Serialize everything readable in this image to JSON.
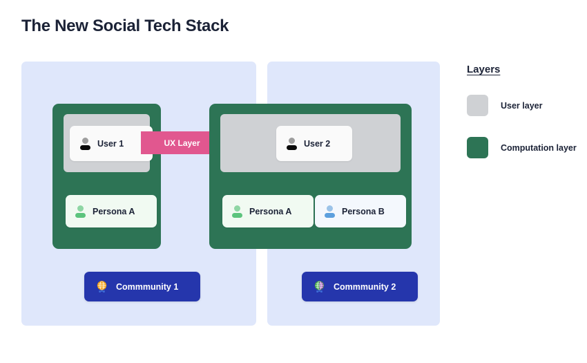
{
  "title": "The New Social Tech Stack",
  "colors": {
    "panel_blue": "#dfe7fb",
    "computation_green": "#2d7455",
    "user_gray": "#cfd1d4",
    "ux_pink": "#e1578f",
    "community_blue": "#2536ac",
    "text_dark": "#1b2236"
  },
  "groups": [
    {
      "id": "left",
      "user": {
        "label": "User 1",
        "icon": "person-icon"
      },
      "personas": [
        {
          "label": "Persona A",
          "icon": "person-icon",
          "tint": "green"
        }
      ],
      "community": {
        "label": "Commmunity 1",
        "icon": "globe-icon"
      }
    },
    {
      "id": "right",
      "user": {
        "label": "User 2",
        "icon": "person-icon"
      },
      "personas": [
        {
          "label": "Persona A",
          "icon": "person-icon",
          "tint": "green"
        },
        {
          "label": "Persona B",
          "icon": "person-icon",
          "tint": "blue"
        }
      ],
      "community": {
        "label": "Commmunity 2",
        "icon": "globe-icon"
      }
    }
  ],
  "connector": {
    "label": "UX Layer"
  },
  "legend": {
    "title": "Layers",
    "items": [
      {
        "label": "User layer",
        "color": "#cfd1d4"
      },
      {
        "label": "Computation layer",
        "color": "#2d7455"
      }
    ]
  }
}
